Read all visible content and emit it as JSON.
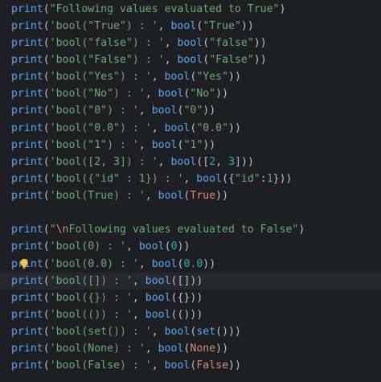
{
  "editor": {
    "language": "Python",
    "lines": [
      "print(\"Following values evaluated to True\")",
      "print('bool(\"True\") : ', bool(\"True\"))",
      "print('bool(\"false\") : ', bool(\"false\"))",
      "print('bool(\"False\") : ', bool(\"False\"))",
      "print('bool(\"Yes\") : ', bool(\"Yes\"))",
      "print('bool(\"No\") : ', bool(\"No\"))",
      "print('bool(\"0\") : ', bool(\"0\"))",
      "print('bool(\"0.0\") : ', bool(\"0.0\"))",
      "print('bool(\"1\") : ', bool(\"1\"))",
      "print('bool([2, 3]) : ', bool([2, 3]))",
      "print('bool({\"id\" : 1}) : ', bool({\"id\":1}))",
      "print('bool(True) : ', bool(True))",
      "",
      "print(\"\\nFollowing values evaluated to False\")",
      "print('bool(0) : ', bool(0))",
      "print('bool(0.0) : ', bool(0.0))",
      "print('bool([]) : ', bool([]))",
      "print('bool({}) : ', bool({}))",
      "print('bool(()) : ', bool(()))",
      "print('bool(set()) : ', bool(set()))",
      "print('bool(None) : ', bool(None))",
      "print('bool(False) : ', bool(False))"
    ],
    "caret_line_index": 16,
    "bulb_line_index": 15
  },
  "colors": {
    "background": "#1e1f22",
    "caret_line": "#26282e",
    "function": "#56a8f5",
    "string": "#6aab73",
    "number": "#2aacb8",
    "keyword": "#cf8e6d",
    "default": "#bcbec4",
    "bulb": "#f2c94c"
  },
  "icons": {
    "intention_bulb": "lightbulb-icon"
  }
}
